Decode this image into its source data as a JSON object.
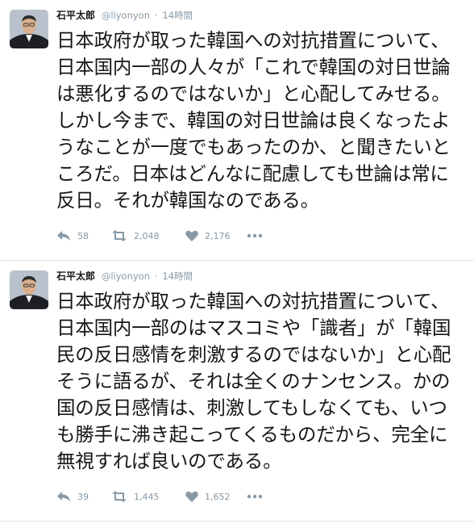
{
  "colors": {
    "icon_gray": "#8899a6",
    "text": "#14171a",
    "divider": "#e1e8ed"
  },
  "tweets": [
    {
      "author_name": "石平太郎",
      "handle": "@liyonyon",
      "separator": "·",
      "time": "14時間",
      "text": "日本政府が取った韓国への対抗措置について、日本国内一部の人々が「これで韓国の対日世論は悪化するのではないか」と心配してみせる。しかし今まで、韓国の対日世論は良くなったようなことが一度でもあったのか、と聞きたいところだ。日本はどんなに配慮しても世論は常に反日。それが韓国なのである。",
      "replies": "58",
      "retweets": "2,048",
      "likes": "2,176",
      "icons": {
        "reply": "reply-icon",
        "retweet": "retweet-icon",
        "like": "heart-icon",
        "more": "more-icon"
      }
    },
    {
      "author_name": "石平太郎",
      "handle": "@liyonyon",
      "separator": "·",
      "time": "14時間",
      "text": "日本政府が取った韓国への対抗措置について、日本国内一部のはマスコミや「識者」が「韓国民の反日感情を刺激するのではないか」と心配そうに語るが、それは全くのナンセンス。かの国の反日感情は、刺激してもしなくても、いつも勝手に沸き起こってくるものだから、完全に無視すれば良いのである。",
      "replies": "39",
      "retweets": "1,445",
      "likes": "1,652",
      "icons": {
        "reply": "reply-icon",
        "retweet": "retweet-icon",
        "like": "heart-icon",
        "more": "more-icon"
      }
    }
  ]
}
